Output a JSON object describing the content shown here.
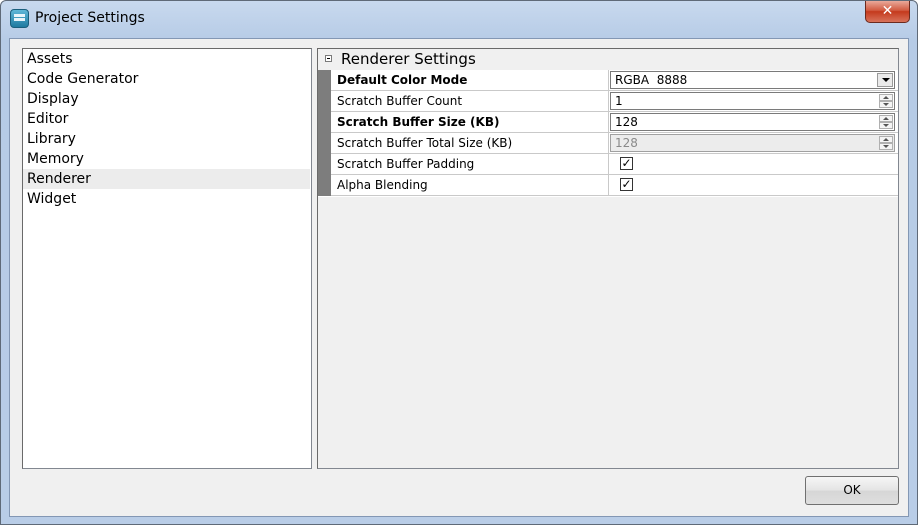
{
  "window": {
    "title": "Project Settings",
    "close_glyph": "✕"
  },
  "icons": {
    "app": "app-icon",
    "close": "close-icon",
    "collapse": "minus-box-icon",
    "dropdown": "chevron-down-icon",
    "spin_up": "spin-up-icon",
    "spin_down": "spin-down-icon",
    "check": "checkmark-icon"
  },
  "sidebar": {
    "selected": "Renderer",
    "items": [
      {
        "label": "Assets"
      },
      {
        "label": "Code Generator"
      },
      {
        "label": "Display"
      },
      {
        "label": "Editor"
      },
      {
        "label": "Library"
      },
      {
        "label": "Memory"
      },
      {
        "label": "Renderer"
      },
      {
        "label": "Widget"
      }
    ]
  },
  "settings": {
    "category": "Renderer Settings",
    "properties": [
      {
        "name": "Default Color Mode",
        "value": "RGBA  8888",
        "bold": true,
        "editor": "dropdown"
      },
      {
        "name": "Scratch Buffer Count",
        "value": "1",
        "bold": false,
        "editor": "spin"
      },
      {
        "name": "Scratch Buffer Size (KB)",
        "value": "128",
        "bold": true,
        "editor": "spin"
      },
      {
        "name": "Scratch Buffer Total Size (KB)",
        "value": "128",
        "bold": false,
        "editor": "spin",
        "disabled": true
      },
      {
        "name": "Scratch Buffer Padding",
        "checked": true,
        "bold": false,
        "editor": "checkbox",
        "check_glyph": "✓"
      },
      {
        "name": "Alpha Blending",
        "checked": true,
        "bold": false,
        "editor": "checkbox",
        "check_glyph": "✓"
      }
    ]
  },
  "footer": {
    "ok_label": "OK"
  }
}
